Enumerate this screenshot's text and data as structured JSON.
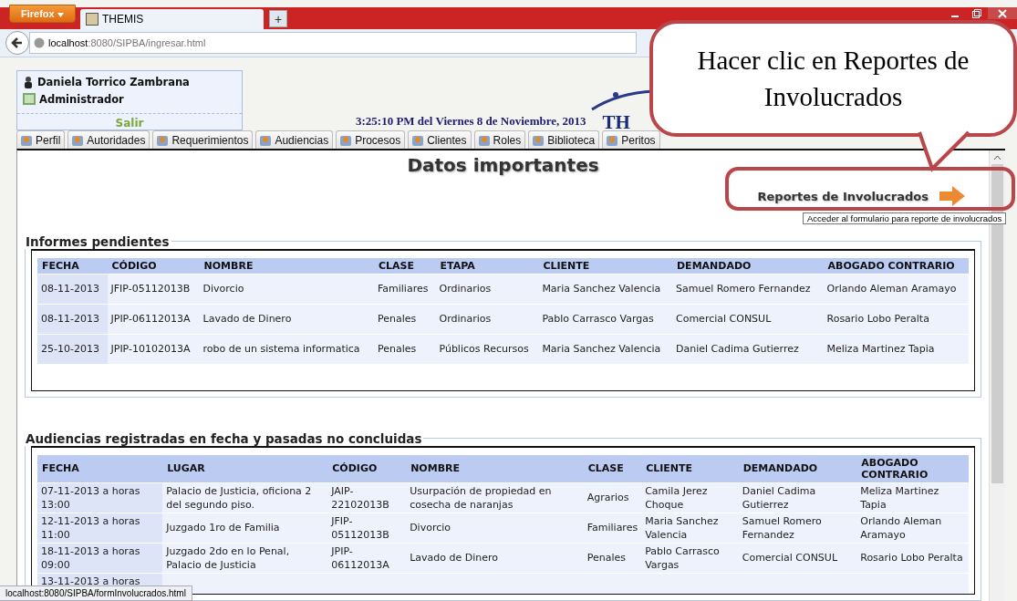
{
  "browser": {
    "menu": "Firefox",
    "tab_title": "THEMIS",
    "new_tab": "+",
    "url_host": "localhost",
    "url_path": ":8080/SIPBA/ingresar.html",
    "status_url": "localhost:8080/SIPBA/formInvolucrados.html"
  },
  "user": {
    "name": "Daniela Torrico Zambrana",
    "role": "Administrador",
    "logout": "Salir"
  },
  "datetime": "3:25:10 PM del Viernes 8 de Noviembre, 2013",
  "logo_text": "TH",
  "tabs": [
    {
      "label": "Perfil",
      "selected": false
    },
    {
      "label": "Autoridades",
      "selected": false
    },
    {
      "label": "Requerimientos",
      "selected": false
    },
    {
      "label": "Audiencias",
      "selected": false
    },
    {
      "label": "Procesos",
      "selected": false
    },
    {
      "label": "Clientes",
      "selected": false
    },
    {
      "label": "Roles",
      "selected": false
    },
    {
      "label": "Biblioteca",
      "selected": false
    },
    {
      "label": "Peritos",
      "selected": false
    }
  ],
  "page_title": "Datos importantes",
  "report_link": {
    "label": "Reportes de Involucrados",
    "tooltip": "Acceder al formulario para reporte de involucrados"
  },
  "callout": "Hacer clic en Reportes de Involucrados",
  "pending_reports": {
    "title": "Informes pendientes",
    "columns": [
      "FECHA",
      "CÓDIGO",
      "NOMBRE",
      "CLASE",
      "ETAPA",
      "CLIENTE",
      "DEMANDADO",
      "ABOGADO CONTRARIO"
    ],
    "rows": [
      [
        "08-11-2013",
        "JFIP-05112013B",
        "Divorcio",
        "Familiares",
        "Ordinarios",
        "Maria Sanchez Valencia",
        "Samuel Romero Fernandez",
        "Orlando Aleman Aramayo"
      ],
      [
        "08-11-2013",
        "JPIP-06112013A",
        "Lavado de Dinero",
        "Penales",
        "Ordinarios",
        "Pablo Carrasco Vargas",
        "Comercial CONSUL",
        "Rosario Lobo Peralta"
      ],
      [
        "25-10-2013",
        "JPIP-10102013A",
        "robo de un sistema informatica",
        "Penales",
        "Públicos Recursos",
        "Maria Sanchez Valencia",
        "Daniel Cadima Gutierrez",
        "Meliza Martinez Tapia"
      ]
    ]
  },
  "hearings": {
    "title": "Audiencias registradas en fecha y pasadas no concluidas",
    "columns": [
      "FECHA",
      "LUGAR",
      "CÓDIGO",
      "NOMBRE",
      "CLASE",
      "CLIENTE",
      "DEMANDADO",
      "ABOGADO CONTRARIO"
    ],
    "rows": [
      [
        "07-11-2013 a horas 13:00",
        "Palacio de Justicia, oficiona 2 del segundo piso.",
        "JAIP-22102013B",
        "Usurpación de propiedad en cosecha de naranjas",
        "Agrarios",
        "Camila Jerez Choque",
        "Daniel Cadima Gutierrez",
        "Meliza Martinez Tapia"
      ],
      [
        "12-11-2013 a horas 11:00",
        "Juzgado 1ro de Familia",
        "JFIP-05112013B",
        "Divorcio",
        "Familiares",
        "Maria Sanchez Valencia",
        "Samuel Romero Fernandez",
        "Orlando Aleman Aramayo"
      ],
      [
        "18-11-2013 a horas 09:00",
        "Juzgado 2do en lo Penal, Palacio de Justicia",
        "JPIP-06112013A",
        "Lavado de Dinero",
        "Penales",
        "Pablo Carrasco Vargas",
        "Comercial CONSUL",
        "Rosario Lobo Peralta"
      ],
      [
        "13-11-2013 a horas"
      ]
    ]
  }
}
